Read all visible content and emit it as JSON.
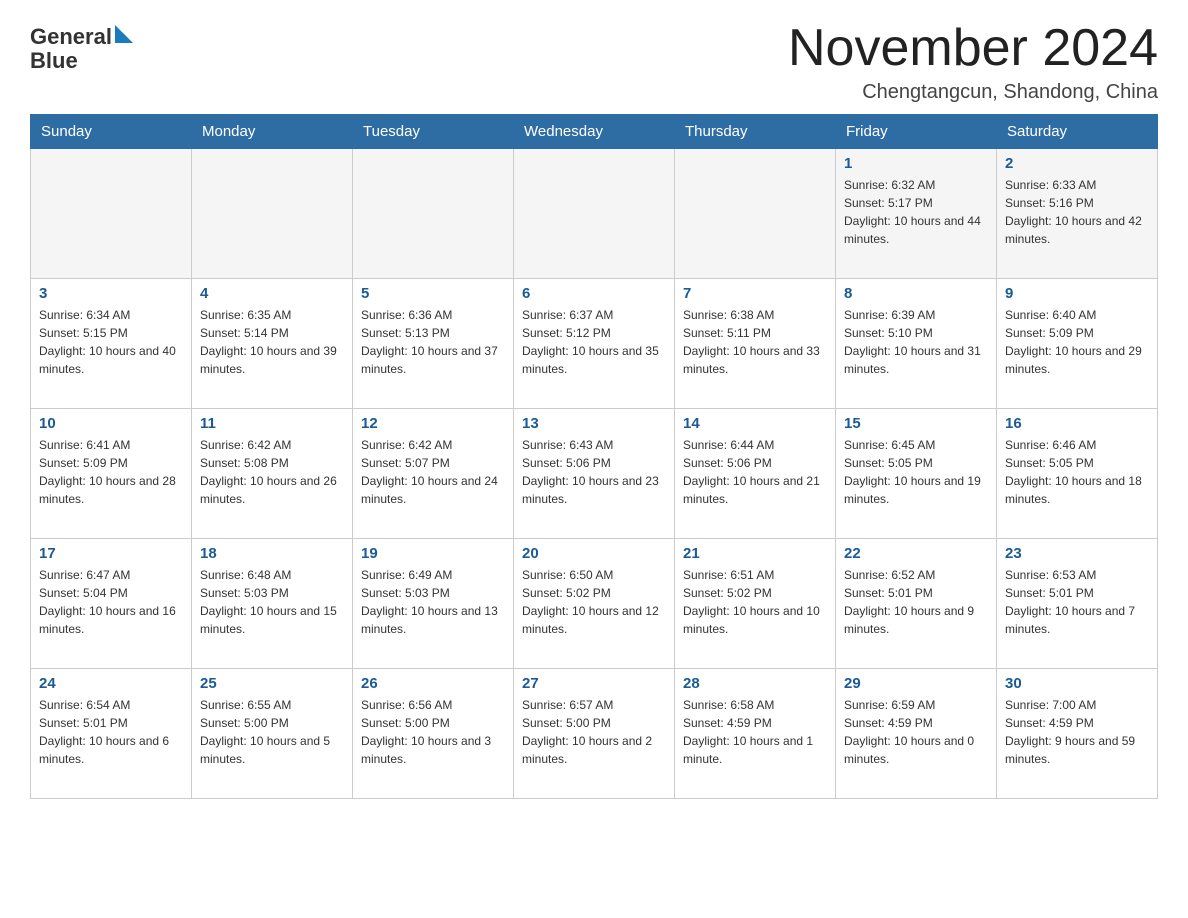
{
  "logo": {
    "text_general": "General",
    "text_blue": "Blue"
  },
  "title": "November 2024",
  "location": "Chengtangcun, Shandong, China",
  "weekdays": [
    "Sunday",
    "Monday",
    "Tuesday",
    "Wednesday",
    "Thursday",
    "Friday",
    "Saturday"
  ],
  "weeks": [
    [
      {
        "day": "",
        "sunrise": "",
        "sunset": "",
        "daylight": ""
      },
      {
        "day": "",
        "sunrise": "",
        "sunset": "",
        "daylight": ""
      },
      {
        "day": "",
        "sunrise": "",
        "sunset": "",
        "daylight": ""
      },
      {
        "day": "",
        "sunrise": "",
        "sunset": "",
        "daylight": ""
      },
      {
        "day": "",
        "sunrise": "",
        "sunset": "",
        "daylight": ""
      },
      {
        "day": "1",
        "sunrise": "Sunrise: 6:32 AM",
        "sunset": "Sunset: 5:17 PM",
        "daylight": "Daylight: 10 hours and 44 minutes."
      },
      {
        "day": "2",
        "sunrise": "Sunrise: 6:33 AM",
        "sunset": "Sunset: 5:16 PM",
        "daylight": "Daylight: 10 hours and 42 minutes."
      }
    ],
    [
      {
        "day": "3",
        "sunrise": "Sunrise: 6:34 AM",
        "sunset": "Sunset: 5:15 PM",
        "daylight": "Daylight: 10 hours and 40 minutes."
      },
      {
        "day": "4",
        "sunrise": "Sunrise: 6:35 AM",
        "sunset": "Sunset: 5:14 PM",
        "daylight": "Daylight: 10 hours and 39 minutes."
      },
      {
        "day": "5",
        "sunrise": "Sunrise: 6:36 AM",
        "sunset": "Sunset: 5:13 PM",
        "daylight": "Daylight: 10 hours and 37 minutes."
      },
      {
        "day": "6",
        "sunrise": "Sunrise: 6:37 AM",
        "sunset": "Sunset: 5:12 PM",
        "daylight": "Daylight: 10 hours and 35 minutes."
      },
      {
        "day": "7",
        "sunrise": "Sunrise: 6:38 AM",
        "sunset": "Sunset: 5:11 PM",
        "daylight": "Daylight: 10 hours and 33 minutes."
      },
      {
        "day": "8",
        "sunrise": "Sunrise: 6:39 AM",
        "sunset": "Sunset: 5:10 PM",
        "daylight": "Daylight: 10 hours and 31 minutes."
      },
      {
        "day": "9",
        "sunrise": "Sunrise: 6:40 AM",
        "sunset": "Sunset: 5:09 PM",
        "daylight": "Daylight: 10 hours and 29 minutes."
      }
    ],
    [
      {
        "day": "10",
        "sunrise": "Sunrise: 6:41 AM",
        "sunset": "Sunset: 5:09 PM",
        "daylight": "Daylight: 10 hours and 28 minutes."
      },
      {
        "day": "11",
        "sunrise": "Sunrise: 6:42 AM",
        "sunset": "Sunset: 5:08 PM",
        "daylight": "Daylight: 10 hours and 26 minutes."
      },
      {
        "day": "12",
        "sunrise": "Sunrise: 6:42 AM",
        "sunset": "Sunset: 5:07 PM",
        "daylight": "Daylight: 10 hours and 24 minutes."
      },
      {
        "day": "13",
        "sunrise": "Sunrise: 6:43 AM",
        "sunset": "Sunset: 5:06 PM",
        "daylight": "Daylight: 10 hours and 23 minutes."
      },
      {
        "day": "14",
        "sunrise": "Sunrise: 6:44 AM",
        "sunset": "Sunset: 5:06 PM",
        "daylight": "Daylight: 10 hours and 21 minutes."
      },
      {
        "day": "15",
        "sunrise": "Sunrise: 6:45 AM",
        "sunset": "Sunset: 5:05 PM",
        "daylight": "Daylight: 10 hours and 19 minutes."
      },
      {
        "day": "16",
        "sunrise": "Sunrise: 6:46 AM",
        "sunset": "Sunset: 5:05 PM",
        "daylight": "Daylight: 10 hours and 18 minutes."
      }
    ],
    [
      {
        "day": "17",
        "sunrise": "Sunrise: 6:47 AM",
        "sunset": "Sunset: 5:04 PM",
        "daylight": "Daylight: 10 hours and 16 minutes."
      },
      {
        "day": "18",
        "sunrise": "Sunrise: 6:48 AM",
        "sunset": "Sunset: 5:03 PM",
        "daylight": "Daylight: 10 hours and 15 minutes."
      },
      {
        "day": "19",
        "sunrise": "Sunrise: 6:49 AM",
        "sunset": "Sunset: 5:03 PM",
        "daylight": "Daylight: 10 hours and 13 minutes."
      },
      {
        "day": "20",
        "sunrise": "Sunrise: 6:50 AM",
        "sunset": "Sunset: 5:02 PM",
        "daylight": "Daylight: 10 hours and 12 minutes."
      },
      {
        "day": "21",
        "sunrise": "Sunrise: 6:51 AM",
        "sunset": "Sunset: 5:02 PM",
        "daylight": "Daylight: 10 hours and 10 minutes."
      },
      {
        "day": "22",
        "sunrise": "Sunrise: 6:52 AM",
        "sunset": "Sunset: 5:01 PM",
        "daylight": "Daylight: 10 hours and 9 minutes."
      },
      {
        "day": "23",
        "sunrise": "Sunrise: 6:53 AM",
        "sunset": "Sunset: 5:01 PM",
        "daylight": "Daylight: 10 hours and 7 minutes."
      }
    ],
    [
      {
        "day": "24",
        "sunrise": "Sunrise: 6:54 AM",
        "sunset": "Sunset: 5:01 PM",
        "daylight": "Daylight: 10 hours and 6 minutes."
      },
      {
        "day": "25",
        "sunrise": "Sunrise: 6:55 AM",
        "sunset": "Sunset: 5:00 PM",
        "daylight": "Daylight: 10 hours and 5 minutes."
      },
      {
        "day": "26",
        "sunrise": "Sunrise: 6:56 AM",
        "sunset": "Sunset: 5:00 PM",
        "daylight": "Daylight: 10 hours and 3 minutes."
      },
      {
        "day": "27",
        "sunrise": "Sunrise: 6:57 AM",
        "sunset": "Sunset: 5:00 PM",
        "daylight": "Daylight: 10 hours and 2 minutes."
      },
      {
        "day": "28",
        "sunrise": "Sunrise: 6:58 AM",
        "sunset": "Sunset: 4:59 PM",
        "daylight": "Daylight: 10 hours and 1 minute."
      },
      {
        "day": "29",
        "sunrise": "Sunrise: 6:59 AM",
        "sunset": "Sunset: 4:59 PM",
        "daylight": "Daylight: 10 hours and 0 minutes."
      },
      {
        "day": "30",
        "sunrise": "Sunrise: 7:00 AM",
        "sunset": "Sunset: 4:59 PM",
        "daylight": "Daylight: 9 hours and 59 minutes."
      }
    ]
  ]
}
